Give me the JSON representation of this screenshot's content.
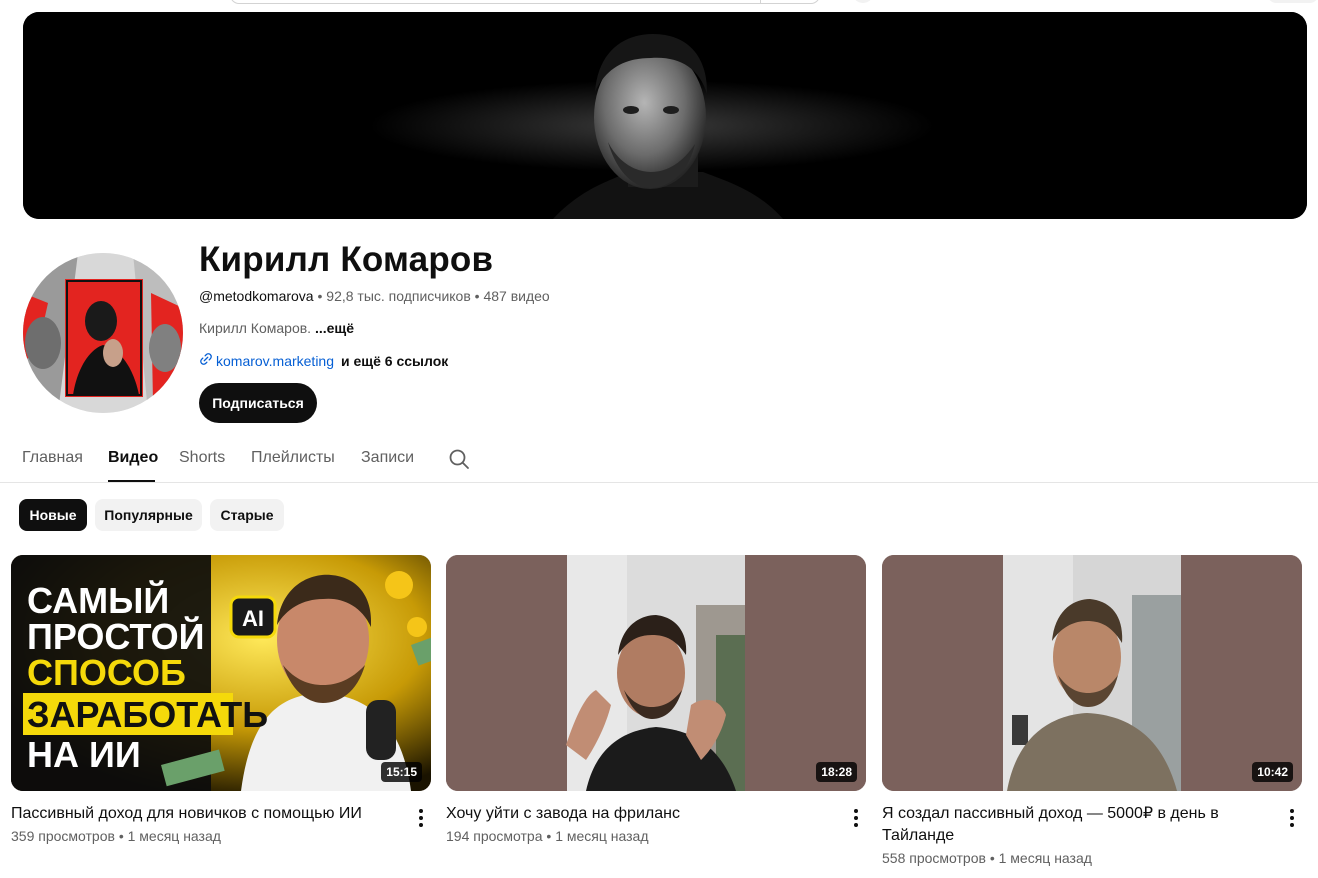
{
  "channel": {
    "name": "Кирилл Комаров",
    "handle": "@metodkomarova",
    "separator": "•",
    "subscribers": "92,8 тыс. подписчиков",
    "videos_count": "487 видео",
    "description": "Кирилл Комаров.",
    "description_more": "...ещё",
    "link": "komarov.marketing",
    "link_more": "и ещё 6 ссылок",
    "subscribe_label": "Подписаться"
  },
  "tabs": [
    {
      "label": "Главная",
      "active": false
    },
    {
      "label": "Видео",
      "active": true
    },
    {
      "label": "Shorts",
      "active": false
    },
    {
      "label": "Плейлисты",
      "active": false
    },
    {
      "label": "Записи",
      "active": false
    }
  ],
  "chips": [
    {
      "label": "Новые",
      "active": true
    },
    {
      "label": "Популярные",
      "active": false
    },
    {
      "label": "Старые",
      "active": false
    }
  ],
  "videos": [
    {
      "title": "Пассивный доход для новичков с помощью ИИ",
      "views": "359 просмотров",
      "age": "1 месяц назад",
      "duration": "15:15",
      "thumb_text": [
        "САМЫЙ",
        "ПРОСТОЙ",
        "СПОСОБ",
        "ЗАРАБОТАТЬ",
        "НА ИИ"
      ],
      "thumb_badge": "AI"
    },
    {
      "title": "Хочу уйти с завода на фриланс",
      "views": "194 просмотра",
      "age": "1 месяц назад",
      "duration": "18:28"
    },
    {
      "title": "Я создал пассивный доход — 5000₽ в день в Тайланде",
      "views": "558 просмотров",
      "age": "1 месяц назад",
      "duration": "10:42"
    }
  ],
  "icons": {
    "link": "link-icon",
    "search": "search-icon",
    "more": "more-vert-icon"
  },
  "colors": {
    "accent_dark": "#0f0f0f",
    "link": "#065fd4",
    "muted": "#606060",
    "thumb_yellow": "#f5d90a",
    "avatar_red": "#e32420"
  }
}
